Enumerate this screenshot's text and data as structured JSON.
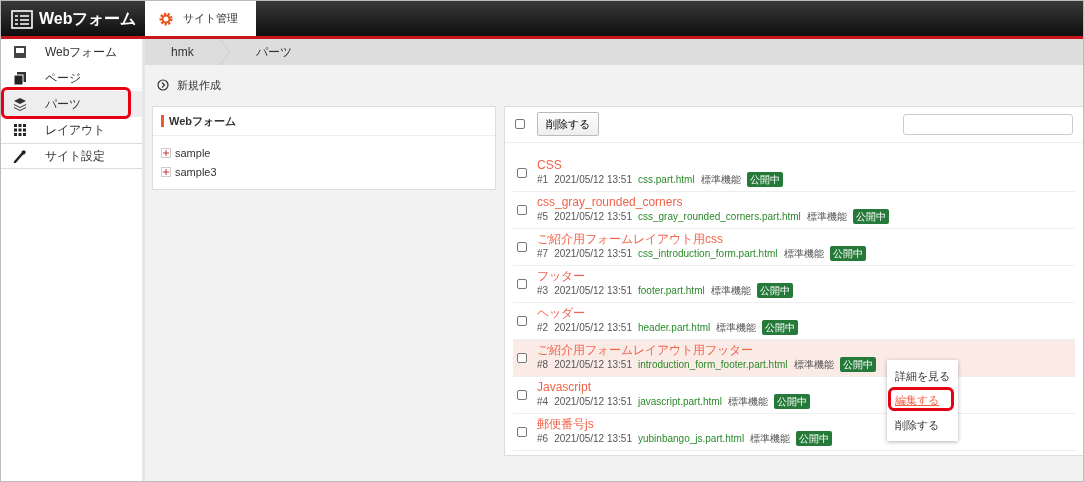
{
  "header": {
    "logo": "Webフォーム",
    "tabs": [
      {
        "label": "サイト管理",
        "selected": true
      }
    ]
  },
  "sidebar": {
    "items": [
      {
        "label": "Webフォーム",
        "selected": false,
        "highlighted": false
      },
      {
        "label": "ページ",
        "selected": false,
        "highlighted": false
      },
      {
        "label": "パーツ",
        "selected": true,
        "highlighted": true
      },
      {
        "label": "レイアウト",
        "selected": false,
        "highlighted": false
      },
      {
        "label": "サイト設定",
        "selected": false,
        "highlighted": false
      }
    ]
  },
  "breadcrumb": [
    "hmk",
    "パーツ"
  ],
  "new_button": "新規作成",
  "tree_panel": {
    "title": "Webフォーム",
    "items": [
      {
        "label": "sample",
        "expanded": false
      },
      {
        "label": "sample3",
        "expanded": false
      }
    ]
  },
  "list_panel": {
    "select_all": false,
    "delete_button": "削除する",
    "rows": [
      {
        "title": "CSS",
        "id": "#1",
        "date": "2021/05/12 13:51",
        "file": "css.part.html",
        "type": "標準機能",
        "status": "公開中",
        "checked": false,
        "selected": false
      },
      {
        "title": "css_gray_rounded_corners",
        "id": "#5",
        "date": "2021/05/12 13:51",
        "file": "css_gray_rounded_corners.part.html",
        "type": "標準機能",
        "status": "公開中",
        "checked": false,
        "selected": false
      },
      {
        "title": "ご紹介用フォームレイアウト用css",
        "id": "#7",
        "date": "2021/05/12 13:51",
        "file": "css_introduction_form.part.html",
        "type": "標準機能",
        "status": "公開中",
        "checked": false,
        "selected": false
      },
      {
        "title": "フッター",
        "id": "#3",
        "date": "2021/05/12 13:51",
        "file": "footer.part.html",
        "type": "標準機能",
        "status": "公開中",
        "checked": false,
        "selected": false
      },
      {
        "title": "ヘッダー",
        "id": "#2",
        "date": "2021/05/12 13:51",
        "file": "header.part.html",
        "type": "標準機能",
        "status": "公開中",
        "checked": false,
        "selected": false
      },
      {
        "title": "ご紹介用フォームレイアウト用フッター",
        "id": "#8",
        "date": "2021/05/12 13:51",
        "file": "introduction_form_footer.part.html",
        "type": "標準機能",
        "status": "公開中",
        "checked": false,
        "selected": true
      },
      {
        "title": "Javascript",
        "id": "#4",
        "date": "2021/05/12 13:51",
        "file": "javascript.part.html",
        "type": "標準機能",
        "status": "公開中",
        "checked": false,
        "selected": false
      },
      {
        "title": "郵便番号js",
        "id": "#6",
        "date": "2021/05/12 13:51",
        "file": "yubinbango_js.part.html",
        "type": "標準機能",
        "status": "公開中",
        "checked": false,
        "selected": false
      }
    ]
  },
  "context_menu": {
    "items": [
      {
        "label": "詳細を見る",
        "highlighted": false
      },
      {
        "label": "編集する",
        "highlighted": true
      },
      {
        "label": "削除する",
        "highlighted": false
      }
    ]
  }
}
